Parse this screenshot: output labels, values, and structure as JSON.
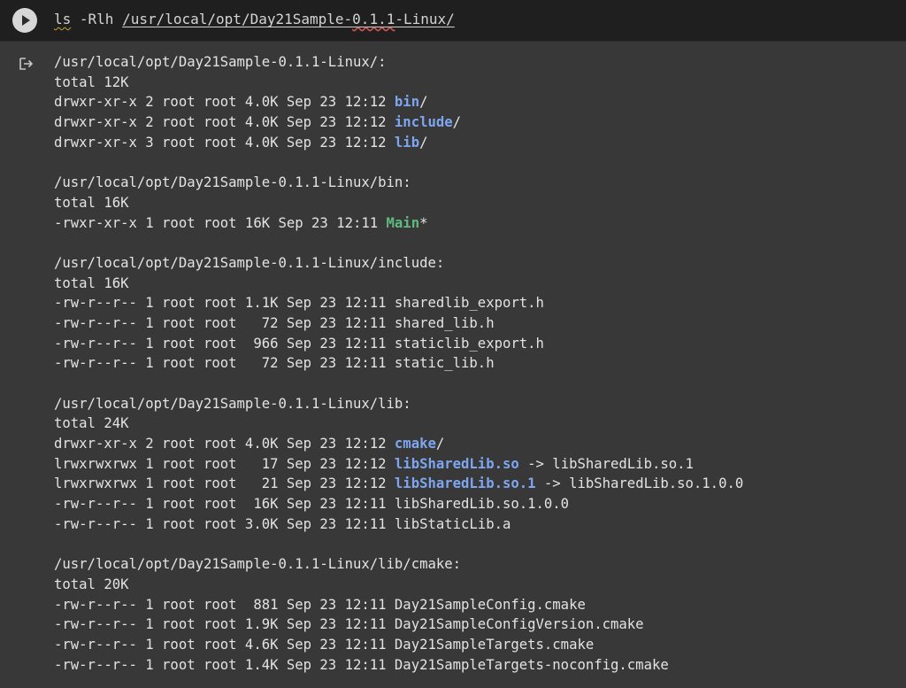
{
  "code_cell": {
    "cmd": "ls",
    "flags": "-Rlh",
    "path_pre": "/usr/local/opt/Day21Sample-",
    "path_ver": "0.1.1",
    "path_post": "-Linux/"
  },
  "output": {
    "sections": [
      {
        "header": "/usr/local/opt/Day21Sample-0.1.1-Linux/:",
        "total": "total 12K",
        "rows": [
          {
            "perm": "drwxr-xr-x 2 root root 4.0K Sep 23 12:12 ",
            "name": "bin",
            "suffix": "/"
          },
          {
            "perm": "drwxr-xr-x 2 root root 4.0K Sep 23 12:12 ",
            "name": "include",
            "suffix": "/"
          },
          {
            "perm": "drwxr-xr-x 3 root root 4.0K Sep 23 12:12 ",
            "name": "lib",
            "suffix": "/"
          }
        ]
      },
      {
        "header": "/usr/local/opt/Day21Sample-0.1.1-Linux/bin:",
        "total": "total 16K",
        "rows": [
          {
            "perm": "-rwxr-xr-x 1 root root 16K Sep 23 12:11 ",
            "name": "Main",
            "suffix": "*"
          }
        ]
      },
      {
        "header": "/usr/local/opt/Day21Sample-0.1.1-Linux/include:",
        "total": "total 16K",
        "rows": [
          {
            "text": "-rw-r--r-- 1 root root 1.1K Sep 23 12:11 sharedlib_export.h"
          },
          {
            "text": "-rw-r--r-- 1 root root   72 Sep 23 12:11 shared_lib.h"
          },
          {
            "text": "-rw-r--r-- 1 root root  966 Sep 23 12:11 staticlib_export.h"
          },
          {
            "text": "-rw-r--r-- 1 root root   72 Sep 23 12:11 static_lib.h"
          }
        ]
      },
      {
        "header": "/usr/local/opt/Day21Sample-0.1.1-Linux/lib:",
        "total": "total 24K",
        "rows": [
          {
            "perm": "drwxr-xr-x 2 root root 4.0K Sep 23 12:12 ",
            "name": "cmake",
            "suffix": "/"
          },
          {
            "perm": "lrwxrwxrwx 1 root root   17 Sep 23 12:12 ",
            "name": "libSharedLib.so",
            "suffix": " -> libSharedLib.so.1"
          },
          {
            "perm": "lrwxrwxrwx 1 root root   21 Sep 23 12:12 ",
            "name": "libSharedLib.so.1",
            "suffix": " -> libSharedLib.so.1.0.0"
          },
          {
            "text": "-rw-r--r-- 1 root root  16K Sep 23 12:11 libSharedLib.so.1.0.0"
          },
          {
            "text": "-rw-r--r-- 1 root root 3.0K Sep 23 12:11 libStaticLib.a"
          }
        ]
      },
      {
        "header": "/usr/local/opt/Day21Sample-0.1.1-Linux/lib/cmake:",
        "total": "total 20K",
        "rows": [
          {
            "text": "-rw-r--r-- 1 root root  881 Sep 23 12:11 Day21SampleConfig.cmake"
          },
          {
            "text": "-rw-r--r-- 1 root root 1.9K Sep 23 12:11 Day21SampleConfigVersion.cmake"
          },
          {
            "text": "-rw-r--r-- 1 root root 4.6K Sep 23 12:11 Day21SampleTargets.cmake"
          },
          {
            "text": "-rw-r--r-- 1 root root 1.4K Sep 23 12:11 Day21SampleTargets-noconfig.cmake"
          }
        ]
      }
    ]
  },
  "icons": {
    "run": "play-icon",
    "output": "output-arrow-icon"
  },
  "colors": {
    "directory": "#7ea6f0",
    "executable": "#5fba7d",
    "symlink": "#7ea6f0"
  }
}
